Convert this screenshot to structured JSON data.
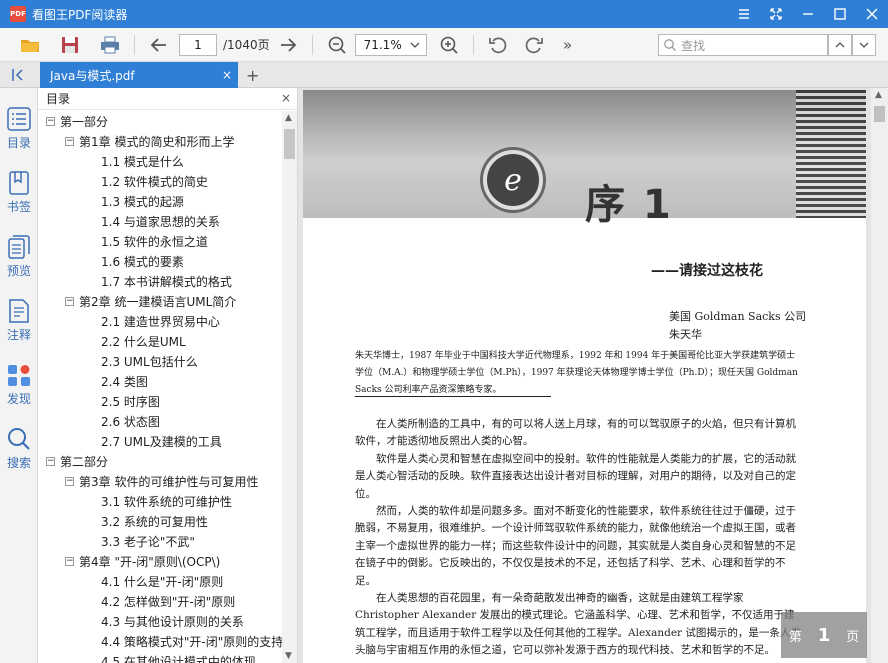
{
  "app": {
    "title": "看图王PDF阅读器",
    "logo_text": "PDF"
  },
  "toolbar": {
    "page_current": "1",
    "page_total": "/1040页",
    "zoom": "71.1%",
    "search_placeholder": "查找",
    "more": "»"
  },
  "tab": {
    "label": "Java与模式.pdf",
    "close": "×",
    "add": "+"
  },
  "rail": {
    "items": [
      {
        "label": "目录",
        "icon": "list-icon"
      },
      {
        "label": "书签",
        "icon": "bookmark-icon"
      },
      {
        "label": "预览",
        "icon": "pages-icon"
      },
      {
        "label": "注释",
        "icon": "note-icon"
      },
      {
        "label": "发现",
        "icon": "apps-icon"
      },
      {
        "label": "搜索",
        "icon": "search-icon"
      }
    ]
  },
  "outline": {
    "title": "目录",
    "close": "×",
    "nodes": [
      {
        "level": 0,
        "toggle": "−",
        "text": "第一部分"
      },
      {
        "level": 1,
        "toggle": "−",
        "text": "第1章 模式的简史和形而上学"
      },
      {
        "level": 2,
        "text": "1.1 模式是什么"
      },
      {
        "level": 2,
        "text": "1.2 软件模式的简史"
      },
      {
        "level": 2,
        "text": "1.3 模式的起源"
      },
      {
        "level": 2,
        "text": "1.4 与道家思想的关系"
      },
      {
        "level": 2,
        "text": "1.5 软件的永恒之道"
      },
      {
        "level": 2,
        "text": "1.6 模式的要素"
      },
      {
        "level": 2,
        "text": "1.7 本书讲解模式的格式"
      },
      {
        "level": 1,
        "toggle": "−",
        "text": "第2章 统一建模语言UML简介"
      },
      {
        "level": 2,
        "text": "2.1 建造世界贸易中心"
      },
      {
        "level": 2,
        "text": "2.2 什么是UML"
      },
      {
        "level": 2,
        "text": "2.3 UML包括什么"
      },
      {
        "level": 2,
        "text": "2.4 类图"
      },
      {
        "level": 2,
        "text": "2.5 时序图"
      },
      {
        "level": 2,
        "text": "2.6 状态图"
      },
      {
        "level": 2,
        "text": "2.7 UML及建模的工具"
      },
      {
        "level": 0,
        "toggle": "−",
        "text": "第二部分"
      },
      {
        "level": 1,
        "toggle": "−",
        "text": "第3章 软件的可维护性与可复用性"
      },
      {
        "level": 2,
        "text": "3.1 软件系统的可维护性"
      },
      {
        "level": 2,
        "text": "3.2 系统的可复用性"
      },
      {
        "level": 2,
        "text": "3.3 老子论\"不武\""
      },
      {
        "level": 1,
        "toggle": "−",
        "text": "第4章 \"开-闭\"原则\\(OCP\\)"
      },
      {
        "level": 2,
        "text": "4.1 什么是\"开-闭\"原则"
      },
      {
        "level": 2,
        "text": "4.2 怎样做到\"开-闭\"原则"
      },
      {
        "level": 2,
        "text": "4.3 与其他设计原则的关系"
      },
      {
        "level": 2,
        "text": "4.4 策略模式对\"开-闭\"原则的支持"
      },
      {
        "level": 2,
        "text": "4.5 在其他设计模式中的体现"
      }
    ]
  },
  "document": {
    "emblem": "e",
    "chapter_title": "序 1",
    "subtitle": "——请接过这枝花",
    "author_line1": "美国 Goldman Sacks 公司",
    "author_line2": "朱天华",
    "bio": "朱天华博士，1987 年毕业于中国科技大学近代物理系，1992 年和 1994 年于美国哥伦比亚大学获建筑学硕士学位（M.A.）和物理学硕士学位（M.Ph），1997 年获理论天体物理学博士学位（Ph.D）；现任天国 Goldman Sacks 公司利率产品资深策略专家。",
    "paragraphs": [
      "在人类所制造的工具中，有的可以将人送上月球，有的可以驾驭原子的火焰，但只有计算机软件，才能透彻地反照出人类的心智。",
      "软件是人类心灵和智慧在虚拟空间中的投射。软件的性能就是人类能力的扩展，它的活动就是人类心智活动的反映。软件直接表达出设计者对目标的理解，对用户的期待，以及对自己的定位。",
      "然而，人类的软件却是问题多多。面对不断变化的性能要求，软件系统往往过于僵硬，过于脆弱，不易复用，很难维护。一个设计师驾驭软件系统的能力，就像他统治一个虚拟王国，或者主宰一个虚拟世界的能力一样；而这些软件设计中的问题，其实就是人类自身心灵和智慧的不足在镜子中的倒影。它反映出的，不仅仅是技术的不足，还包括了科学、艺术、心理和哲学的不足。",
      "在人类思想的百花园里，有一朵奇葩散发出神奇的幽香，这就是由建筑工程学家 Christopher Alexander 发展出的模式理论。它涵盖科学、心理、艺术和哲学，不仅适用于建筑工程学，而且适用于软件工程学以及任何其他的工程学。Alexander 试图揭示的，是一条人类头脑与宇宙相互作用的永恒之道，它可以弥补发源于西方的现代科技、艺术和哲学的不足。"
    ]
  },
  "page_indicator": {
    "prefix": "第",
    "number": "1",
    "suffix": "页"
  },
  "colors": {
    "accent": "#2f7fd6",
    "rail_icon": "#3a6fb5"
  }
}
